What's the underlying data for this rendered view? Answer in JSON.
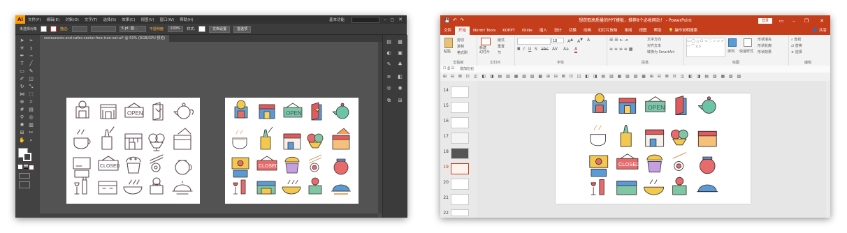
{
  "illustrator": {
    "logo": "Ai",
    "menu": [
      "文件(F)",
      "编辑(E)",
      "对象(O)",
      "文字(T)",
      "选择(S)",
      "效果(C)",
      "视图(V)",
      "窗口(W)",
      "帮助(H)"
    ],
    "workspace": "基本功能",
    "control": {
      "selection_label": "未选择对象",
      "stroke_label": "描边:",
      "stroke_value": "5 pt. 圆...",
      "opacity_label": "不透明度:",
      "opacity_value": "100%",
      "style_label": "样式:",
      "doc_setup": "文档设置",
      "preferences": "首选项"
    },
    "doc_tab": "restaurants-and-cafes-vector-free-icon-set.ai* @ 50% (RGB/GPU 预览)"
  },
  "powerpoint": {
    "title": "想获取高质量的PPT模板，推荐8个必收网站！ - PowerPoint",
    "login": "登录",
    "tabs": [
      "文件",
      "开始",
      "Nordri Tools",
      "KOPPT",
      "iSlide",
      "插入",
      "设计",
      "切换",
      "动画",
      "幻灯片放映",
      "审阅",
      "视图",
      "帮助",
      "操作说明搜索"
    ],
    "share": "共享",
    "groups": {
      "clipboard": "剪贴板",
      "slides": "幻灯片",
      "font": "字体",
      "paragraph": "段落",
      "drawing": "绘图",
      "editing": "编辑"
    },
    "ribbon": {
      "paste": "粘贴",
      "cut": "剪切",
      "copy": "复制",
      "format_painter": "格式刷",
      "new_slide": "新建\n幻灯片",
      "layout": "版式",
      "reset": "重置",
      "section": "节",
      "font_size": "18",
      "text_direction": "文字方向",
      "align_text": "对齐文本",
      "convert_smartart": "转换为 SmartArt",
      "arrange": "排列",
      "quick_styles": "快速样式",
      "shape_fill": "形状填充",
      "shape_outline": "形状轮廓",
      "shape_effects": "形状效果",
      "find": "查找",
      "replace": "替换",
      "select": "选择"
    },
    "toolbar_zoom": "增加左右",
    "slide_numbers": [
      "14",
      "15",
      "16",
      "17",
      "18",
      "19",
      "20",
      "21",
      "22"
    ],
    "active_slide": "19"
  }
}
